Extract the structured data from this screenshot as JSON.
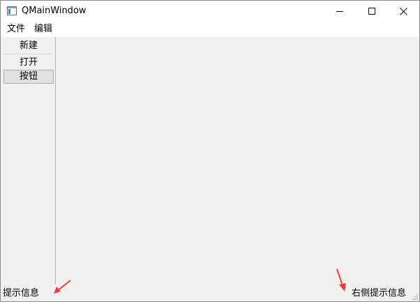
{
  "window": {
    "title": "QMainWindow"
  },
  "menubar": {
    "items": [
      "文件",
      "编辑"
    ]
  },
  "toolbar": {
    "buttons": [
      "新建",
      "打开",
      "按钮"
    ]
  },
  "statusbar": {
    "left_message": "提示信息",
    "right_message": "右侧提示信息"
  },
  "icons": {
    "app": "window-icon",
    "minimize": "minimize-icon",
    "maximize": "maximize-icon",
    "close": "close-icon",
    "size_grip": "size-grip-icon",
    "annotation": "arrow-icon"
  },
  "colors": {
    "annotation_arrow": "#f23b3b",
    "client_background": "#f0f0f0",
    "titlebar_background": "#ffffff"
  }
}
